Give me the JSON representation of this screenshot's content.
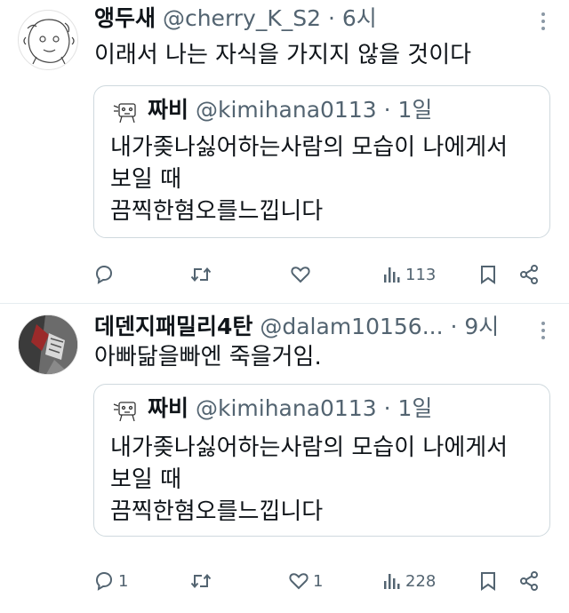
{
  "tweets": [
    {
      "name": "앵두새",
      "handle": "@cherry_K_S2",
      "separator": "·",
      "time": "6시",
      "text": "이래서 나는 자식을 가지지 않을 것이다",
      "quote": {
        "name": "짜비",
        "handle": "@kimihana0113",
        "separator": "·",
        "time": "1일",
        "lines": [
          "내가좆나싫어하는사람의 모습이 나에게서",
          "보일 때",
          "끔찍한혐오를느낍니다"
        ]
      },
      "actions": {
        "replies": "",
        "retweets": "",
        "likes": "",
        "views": "113"
      }
    },
    {
      "name": "데덴지패밀리4탄",
      "handle": "@dalam10156...",
      "separator": "·",
      "time": "9시",
      "text": "아빠닮을빠엔 죽을거임.",
      "quote": {
        "name": "짜비",
        "handle": "@kimihana0113",
        "separator": "·",
        "time": "1일",
        "lines": [
          "내가좆나싫어하는사람의 모습이 나에게서",
          "보일 때",
          "끔찍한혐오를느낍니다"
        ]
      },
      "actions": {
        "replies": "1",
        "retweets": "",
        "likes": "1",
        "views": "228"
      }
    }
  ],
  "icons": [
    "more-icon",
    "reply-icon",
    "retweet-icon",
    "like-icon",
    "views-icon",
    "bookmark-icon",
    "share-icon"
  ],
  "colors": {
    "text": "#0f1419",
    "secondary": "#536471",
    "border": "#cfd9de"
  }
}
